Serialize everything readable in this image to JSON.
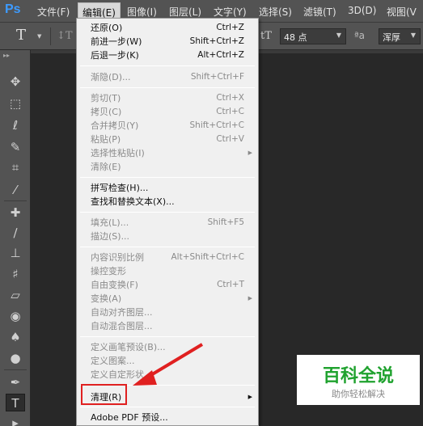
{
  "app": {
    "logo": "Ps"
  },
  "menubar": {
    "items": [
      "文件(F)",
      "编辑(E)",
      "图像(I)",
      "图层(L)",
      "文字(Y)",
      "选择(S)",
      "滤镜(T)",
      "3D(D)",
      "视图(V"
    ],
    "active": "编辑(E)"
  },
  "options": {
    "tool_glyph": "T",
    "font_size": "48 点",
    "antialias_label": "ªa",
    "antialias_value": "浑厚"
  },
  "edit_menu": {
    "items": [
      {
        "label": "还原(O)",
        "shortcut": "Ctrl+Z",
        "disabled": false
      },
      {
        "label": "前进一步(W)",
        "shortcut": "Shift+Ctrl+Z",
        "disabled": false
      },
      {
        "label": "后退一步(K)",
        "shortcut": "Alt+Ctrl+Z",
        "disabled": false
      },
      {
        "label": "渐隐(D)...",
        "shortcut": "Shift+Ctrl+F",
        "disabled": true
      },
      {
        "label": "剪切(T)",
        "shortcut": "Ctrl+X",
        "disabled": true
      },
      {
        "label": "拷贝(C)",
        "shortcut": "Ctrl+C",
        "disabled": true
      },
      {
        "label": "合并拷贝(Y)",
        "shortcut": "Shift+Ctrl+C",
        "disabled": true
      },
      {
        "label": "粘贴(P)",
        "shortcut": "Ctrl+V",
        "disabled": true
      },
      {
        "label": "选择性粘贴(I)",
        "shortcut": "",
        "disabled": true,
        "submenu": true
      },
      {
        "label": "清除(E)",
        "shortcut": "",
        "disabled": true
      },
      {
        "label": "拼写检查(H)...",
        "shortcut": "",
        "disabled": false
      },
      {
        "label": "查找和替换文本(X)...",
        "shortcut": "",
        "disabled": false
      },
      {
        "label": "填充(L)...",
        "shortcut": "Shift+F5",
        "disabled": true
      },
      {
        "label": "描边(S)...",
        "shortcut": "",
        "disabled": true
      },
      {
        "label": "内容识别比例",
        "shortcut": "Alt+Shift+Ctrl+C",
        "disabled": true
      },
      {
        "label": "操控变形",
        "shortcut": "",
        "disabled": true
      },
      {
        "label": "自由变换(F)",
        "shortcut": "Ctrl+T",
        "disabled": true
      },
      {
        "label": "变换(A)",
        "shortcut": "",
        "disabled": true,
        "submenu": true
      },
      {
        "label": "自动对齐图层...",
        "shortcut": "",
        "disabled": true
      },
      {
        "label": "自动混合图层...",
        "shortcut": "",
        "disabled": true
      },
      {
        "label": "定义画笔预设(B)...",
        "shortcut": "",
        "disabled": true
      },
      {
        "label": "定义图案...",
        "shortcut": "",
        "disabled": true
      },
      {
        "label": "定义自定形状...",
        "shortcut": "",
        "disabled": true
      },
      {
        "label": "清理(R)",
        "shortcut": "",
        "disabled": false,
        "submenu": true
      },
      {
        "label": "Adobe PDF 预设...",
        "shortcut": "",
        "disabled": false
      }
    ]
  },
  "watermark": {
    "title": "百科全说",
    "subtitle": "助你轻松解决"
  },
  "colors": {
    "accent": "#e02020",
    "brand": "#1fa22e",
    "ps_blue": "#3d9bff"
  }
}
